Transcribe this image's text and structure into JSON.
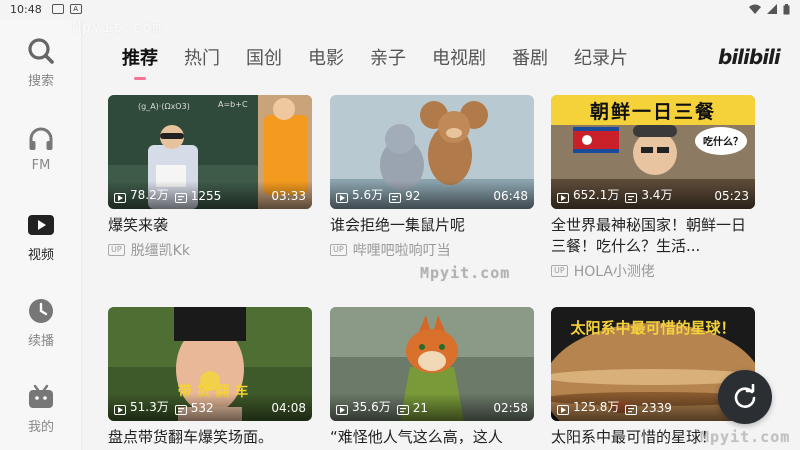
{
  "status": {
    "time": "10:48",
    "badge": "A"
  },
  "watermark": "Mpyit.com",
  "rail": [
    {
      "label": "搜索",
      "icon": "search-icon"
    },
    {
      "label": "FM",
      "icon": "headphones-icon"
    },
    {
      "label": "视频",
      "icon": "video-icon"
    },
    {
      "label": "续播",
      "icon": "clock-icon"
    },
    {
      "label": "我的",
      "icon": "tv-icon"
    }
  ],
  "tabs": [
    "推荐",
    "热门",
    "国创",
    "电影",
    "亲子",
    "电视剧",
    "番剧",
    "纪录片"
  ],
  "logo": "bilibili",
  "accent": "#fb7299",
  "videos": [
    {
      "views": "78.2万",
      "danmaku": "1255",
      "duration": "03:33",
      "title": "爆笑来袭",
      "uploader": "脱缰凯Kk",
      "thumb_text": ""
    },
    {
      "views": "5.6万",
      "danmaku": "92",
      "duration": "06:48",
      "title": "谁会拒绝一集鼠片呢",
      "uploader": "哔哩吧啦响叮当",
      "thumb_text": ""
    },
    {
      "views": "652.1万",
      "danmaku": "3.4万",
      "duration": "05:23",
      "title": "全世界最神秘国家！朝鲜一日三餐！吃什么？生活...",
      "uploader": "HOLA小测佬",
      "thumb_text": "朝鲜一日三餐",
      "thumb_text2": "吃什么？"
    },
    {
      "views": "51.3万",
      "danmaku": "532",
      "duration": "04:08",
      "title": "盘点带货翻车爆笑场面。",
      "uploader": "",
      "thumb_text": "带 货 翻 车"
    },
    {
      "views": "35.6万",
      "danmaku": "21",
      "duration": "02:58",
      "title": "“难怪他人气这么高，这人",
      "uploader": "",
      "thumb_text": ""
    },
    {
      "views": "125.8万",
      "danmaku": "2339",
      "duration": "",
      "title": "太阳系中最可惜的星球！",
      "uploader": "",
      "thumb_text": "太阳系中最可惜的星球！"
    }
  ],
  "up_tag": "UP"
}
